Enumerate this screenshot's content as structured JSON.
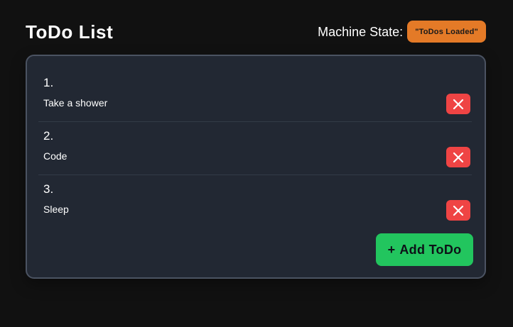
{
  "header": {
    "title": "ToDo List",
    "machine_state_label": "Machine State:",
    "machine_state_value": "\"ToDos Loaded\""
  },
  "todos": [
    {
      "number": "1.",
      "text": "Take a shower",
      "delete_icon": "close-icon"
    },
    {
      "number": "2.",
      "text": "Code",
      "delete_icon": "close-icon"
    },
    {
      "number": "3.",
      "text": "Sleep",
      "delete_icon": "close-icon"
    }
  ],
  "add_button": {
    "icon": "+",
    "label": "Add ToDo"
  },
  "colors": {
    "background": "#111111",
    "card": "#222833",
    "card_border": "#4b5362",
    "state_badge": "#e47a27",
    "delete": "#ef4444",
    "add": "#22c55e"
  }
}
